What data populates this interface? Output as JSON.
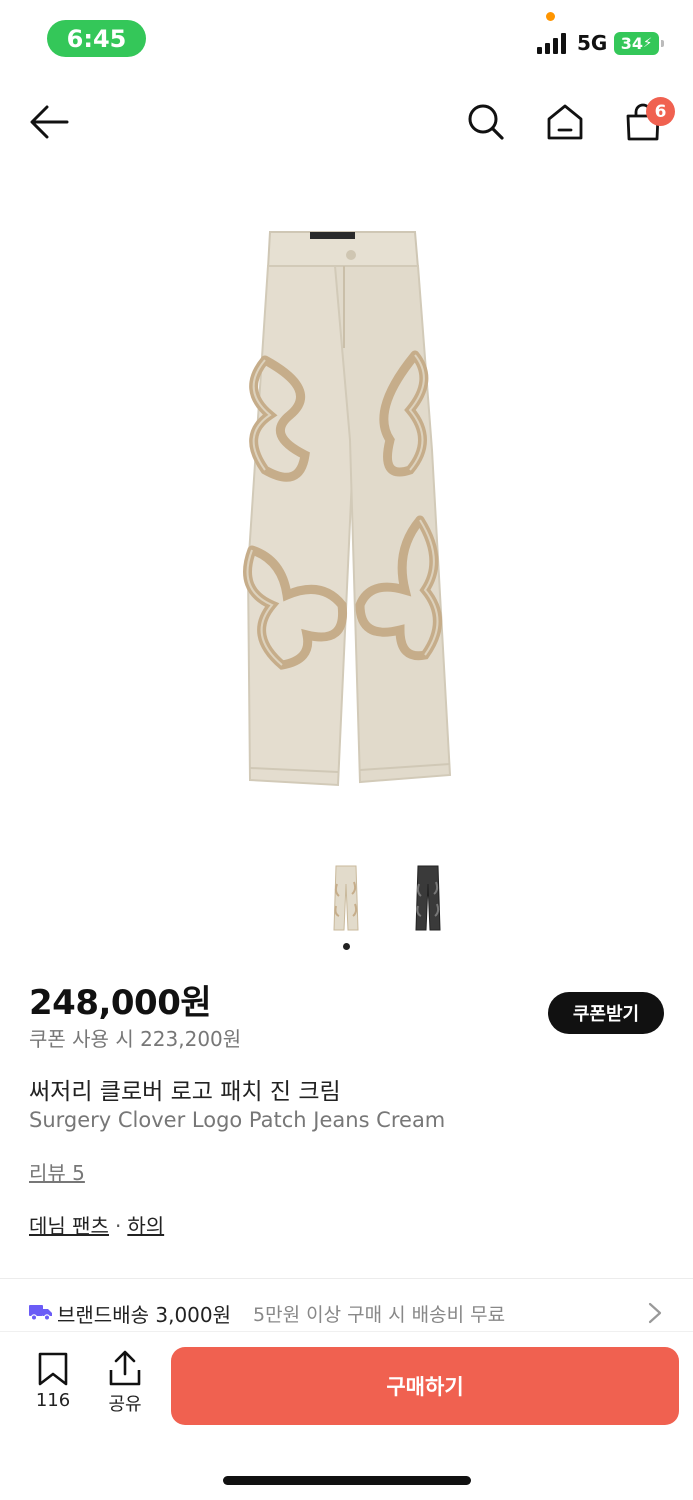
{
  "status_bar": {
    "time": "6:45",
    "network": "5G",
    "battery": "34"
  },
  "header": {
    "cart_count": "6",
    "icons": [
      "back-arrow-icon",
      "search-icon",
      "home-icon",
      "cart-icon"
    ]
  },
  "gallery": {
    "thumbnails": [
      "cream-jeans-thumbnail",
      "black-jeans-thumbnail"
    ],
    "active_index": 0
  },
  "product": {
    "price": "248,000원",
    "coupon_price": "쿠폰 사용 시 223,200원",
    "coupon_button": "쿠폰받기",
    "name_ko": "써저리 클로버 로고 패치 진 크림",
    "name_en": "Surgery Clover Logo Patch Jeans Cream",
    "review_link": "리뷰 5",
    "category_1": "데님 팬츠",
    "category_sep": "·",
    "category_2": "하의"
  },
  "shipping": {
    "label": "브랜드배송 3,000원",
    "note": "5만원 이상 구매 시 배송비 무료"
  },
  "bottom_bar": {
    "bookmark_count": "116",
    "share_label": "공유",
    "buy_label": "구매하기"
  },
  "colors": {
    "accent": "#f06150",
    "status_green": "#34c759",
    "truck": "#6b5cf6"
  }
}
